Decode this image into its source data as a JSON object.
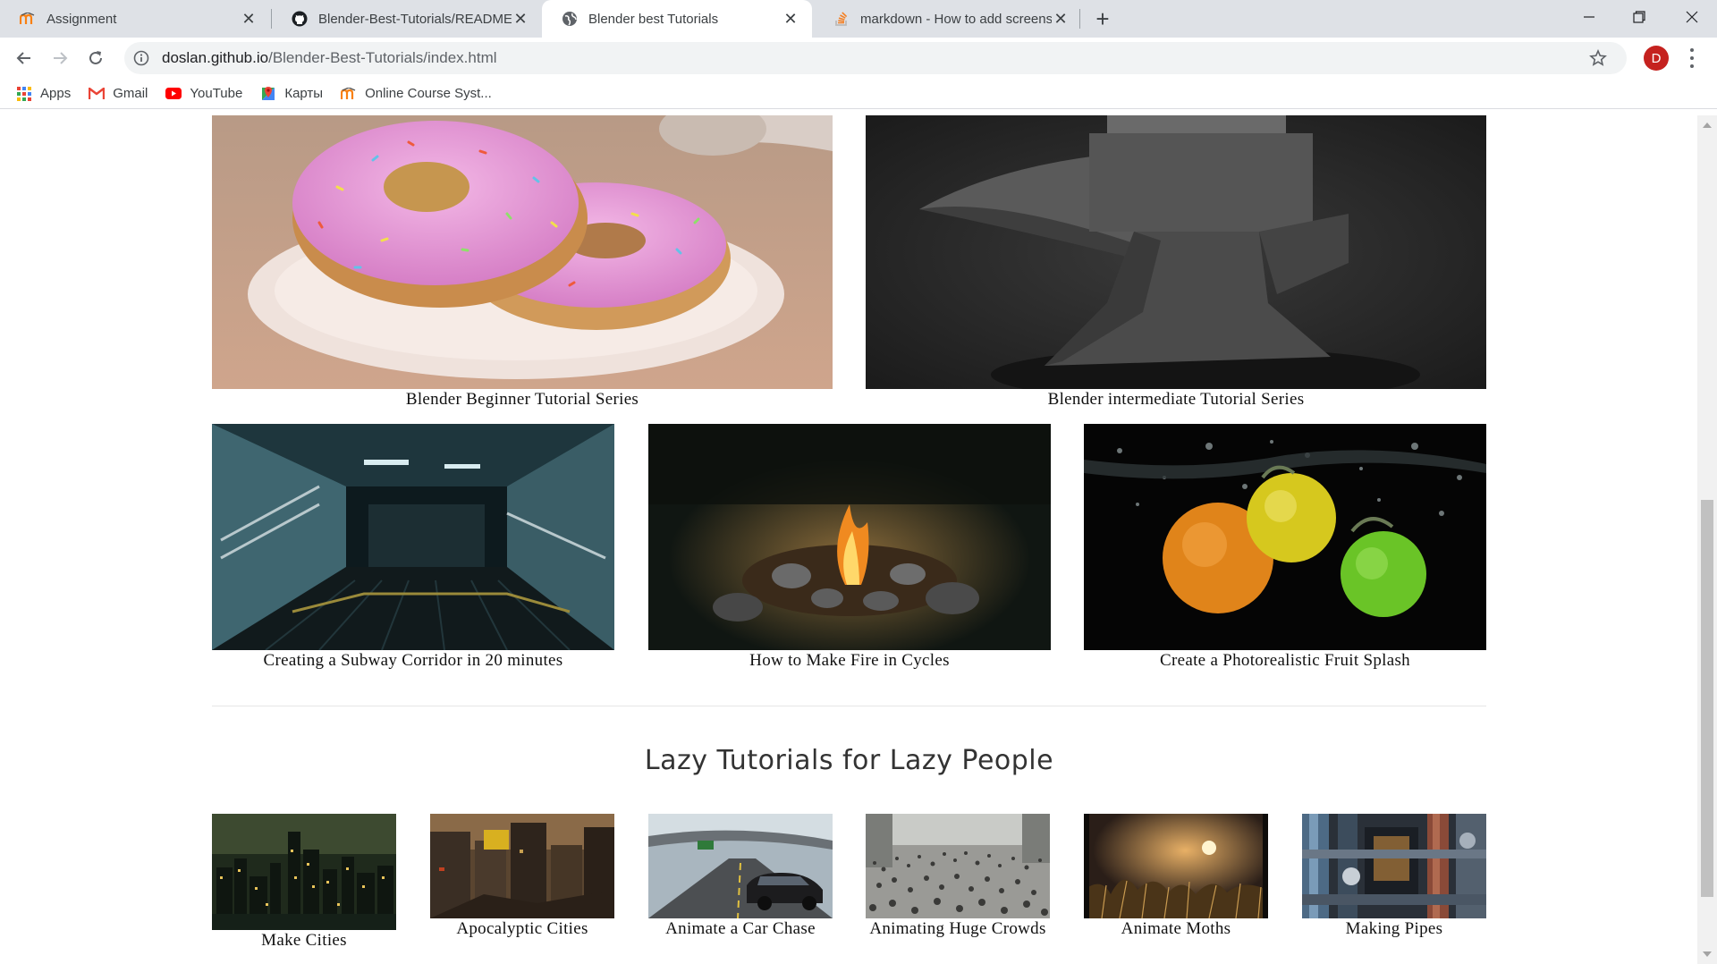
{
  "browser": {
    "tabs": [
      {
        "title": "Assignment",
        "icon": "moodle-icon",
        "active": false
      },
      {
        "title": "Blender-Best-Tutorials/README.r",
        "icon": "github-icon",
        "active": false
      },
      {
        "title": "Blender best Tutorials",
        "icon": "globe-icon",
        "active": true
      },
      {
        "title": "markdown - How to add screens",
        "icon": "stackoverflow-icon",
        "active": false
      }
    ],
    "new_tab_label": "+",
    "url_host": "doslan.github.io",
    "url_path": "/Blender-Best-Tutorials/index.html",
    "profile_initial": "D",
    "bookmarks": [
      {
        "label": "Apps",
        "icon": "apps-grid-icon"
      },
      {
        "label": "Gmail",
        "icon": "gmail-icon"
      },
      {
        "label": "YouTube",
        "icon": "youtube-icon"
      },
      {
        "label": "Карты",
        "icon": "maps-icon"
      },
      {
        "label": "Online Course Syst...",
        "icon": "moodle-icon"
      }
    ]
  },
  "page": {
    "featured": [
      {
        "caption": "Blender Beginner Tutorial Series",
        "image": "donuts"
      },
      {
        "caption": "Blender intermediate Tutorial Series",
        "image": "anvil"
      }
    ],
    "advanced": [
      {
        "caption": "Creating a Subway Corridor in 20 minutes",
        "image": "subway"
      },
      {
        "caption": "How to Make Fire in Cycles",
        "image": "campfire"
      },
      {
        "caption": "Create a Photorealistic Fruit Splash",
        "image": "fruit-splash"
      }
    ],
    "lazy_section_title": "Lazy Tutorials for Lazy People",
    "lazy": [
      {
        "caption": "Make Cities",
        "image": "city-night"
      },
      {
        "caption": "Apocalyptic Cities",
        "image": "ruined-city"
      },
      {
        "caption": "Animate a Car Chase",
        "image": "car-chase"
      },
      {
        "caption": "Animating Huge Crowds",
        "image": "crowd"
      },
      {
        "caption": "Animate Moths",
        "image": "moths"
      },
      {
        "caption": "Making Pipes",
        "image": "pipes"
      }
    ]
  }
}
